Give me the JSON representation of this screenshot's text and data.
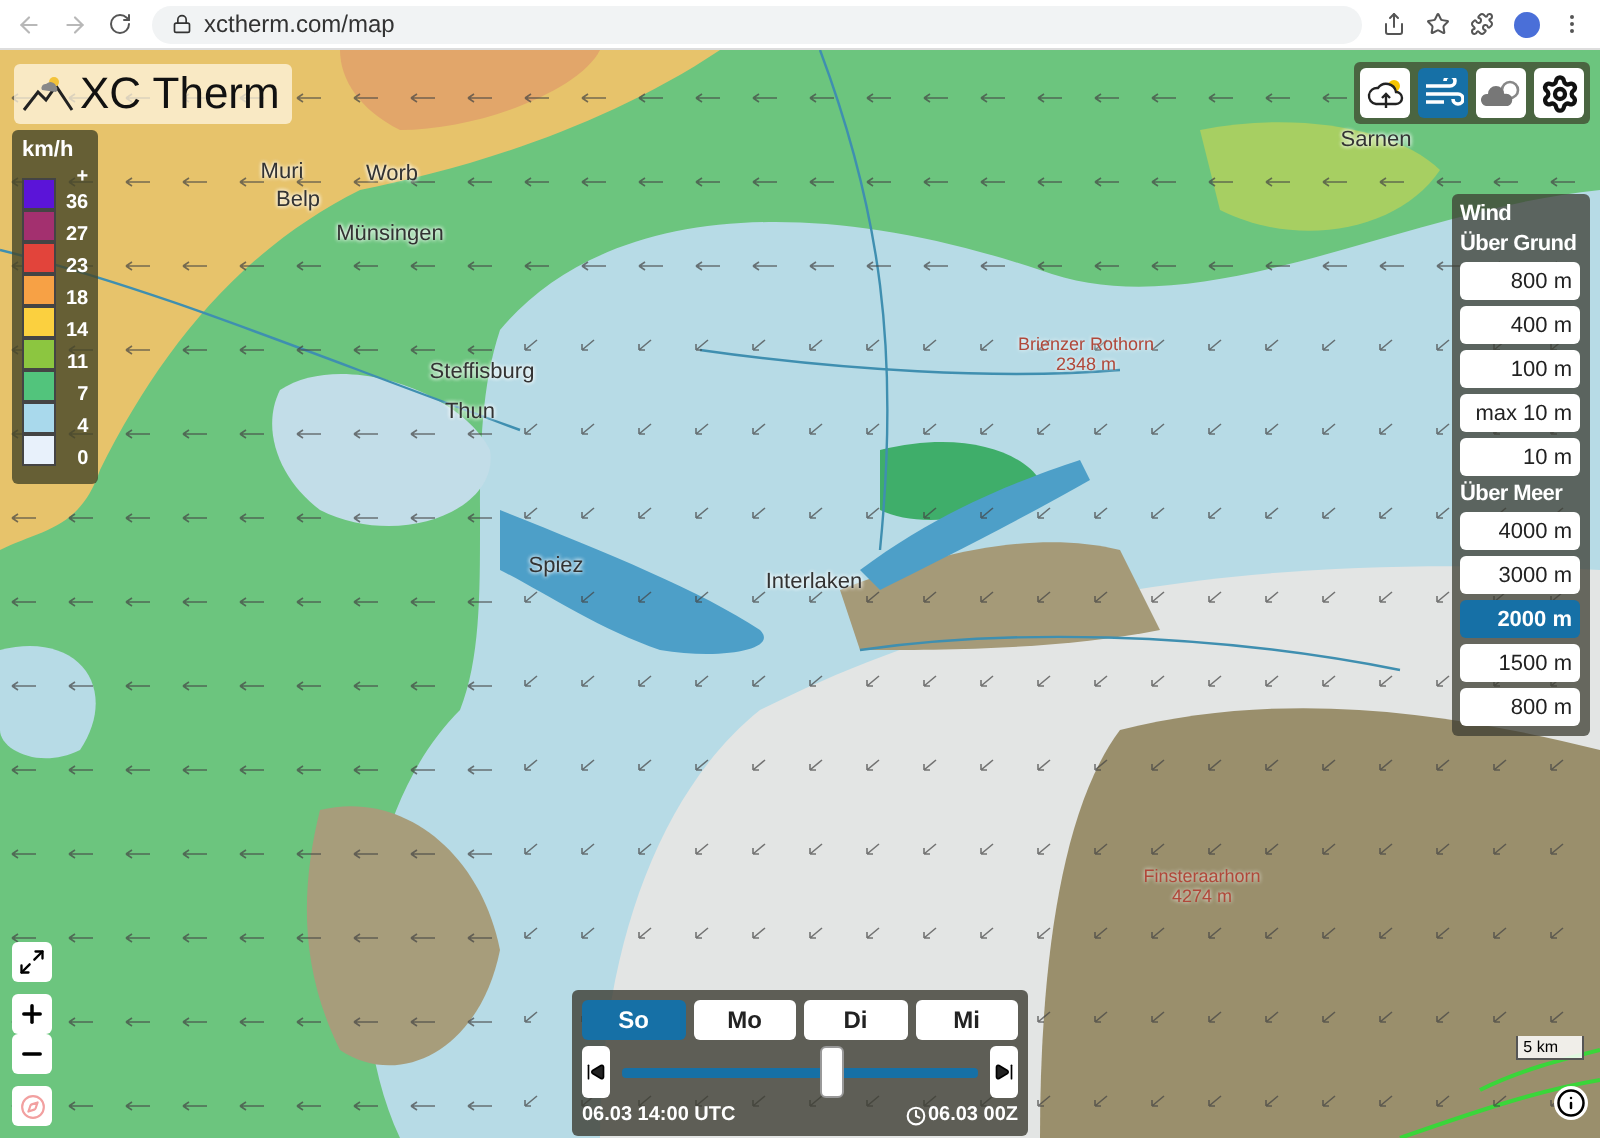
{
  "browser": {
    "url": "xctherm.com/map"
  },
  "logo": {
    "title": "XC Therm"
  },
  "legend": {
    "unit": "km/h",
    "labels": [
      "+",
      "36",
      "27",
      "23",
      "18",
      "14",
      "11",
      "7",
      "4",
      "0"
    ],
    "swatches": [
      {
        "color": "#5b14d8"
      },
      {
        "color": "#a3306f"
      },
      {
        "color": "#e2443b"
      },
      {
        "color": "#f7a145"
      },
      {
        "color": "#fbd03f"
      },
      {
        "color": "#8cc640"
      },
      {
        "color": "#52c47c"
      },
      {
        "color": "#a9d9ec"
      },
      {
        "color": "#e8f1fb"
      }
    ]
  },
  "layers": [
    {
      "kind": "thermal",
      "selected": false
    },
    {
      "kind": "wind",
      "selected": true
    },
    {
      "kind": "clouds",
      "selected": false
    },
    {
      "kind": "settings",
      "selected": false
    }
  ],
  "wind_panel": {
    "title": "Wind",
    "groups": [
      {
        "heading": "Über Grund",
        "levels": [
          {
            "label": "800 m",
            "selected": false
          },
          {
            "label": "400 m",
            "selected": false
          },
          {
            "label": "100 m",
            "selected": false
          },
          {
            "label": "max 10 m",
            "selected": false
          },
          {
            "label": "10 m",
            "selected": false
          }
        ]
      },
      {
        "heading": "Über Meer",
        "levels": [
          {
            "label": "4000 m",
            "selected": false
          },
          {
            "label": "3000 m",
            "selected": false
          },
          {
            "label": "2000 m",
            "selected": true
          },
          {
            "label": "1500 m",
            "selected": false
          },
          {
            "label": "800 m",
            "selected": false
          }
        ]
      }
    ]
  },
  "places": [
    {
      "name": "Muri"
    },
    {
      "name": "Worb"
    },
    {
      "name": "Belp"
    },
    {
      "name": "Münsingen"
    },
    {
      "name": "Steffisburg"
    },
    {
      "name": "Thun"
    },
    {
      "name": "Spiez"
    },
    {
      "name": "Interlaken"
    },
    {
      "name": "Sarnen"
    }
  ],
  "peaks": [
    {
      "name": "Brienzer Rothorn",
      "elevation": "2348 m"
    },
    {
      "name": "Finsteraarhorn",
      "elevation": "4274 m"
    }
  ],
  "timeline": {
    "days": [
      {
        "label": "So",
        "selected": true
      },
      {
        "label": "Mo",
        "selected": false
      },
      {
        "label": "Di",
        "selected": false
      },
      {
        "label": "Mi",
        "selected": false
      }
    ],
    "level": 0.59,
    "time": "06.03 14:00 UTC",
    "model_run": "06.03 00Z"
  },
  "map_controls": {
    "compass_disabled": true
  },
  "scale": "5 km"
}
